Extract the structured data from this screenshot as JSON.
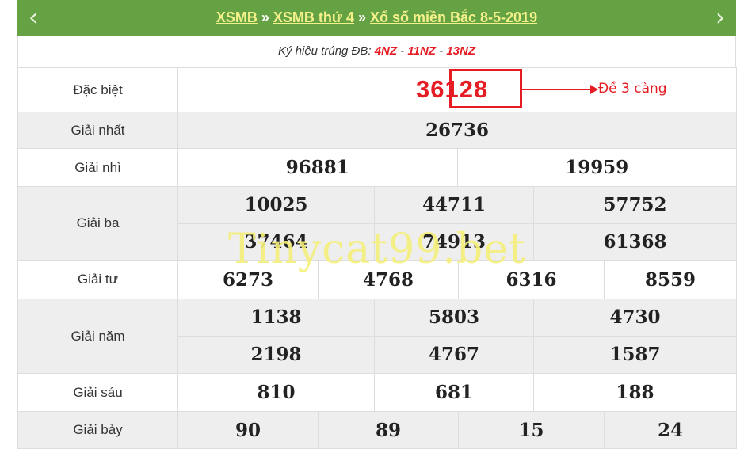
{
  "nav": {
    "prev": "‹",
    "next": "›"
  },
  "breadcrumb": {
    "items": [
      "XSMB",
      "XSMB thứ 4",
      "Xổ số miền Bắc 8-5-2019"
    ],
    "separator": "»"
  },
  "kyhieu": {
    "label": "Ký hiệu trúng ĐB:",
    "codes": [
      "4NZ",
      "11NZ",
      "13NZ"
    ],
    "dash": "-"
  },
  "prizes": {
    "dac_biet": {
      "label": "Đặc biệt",
      "number": "36128",
      "prefix": "36",
      "highlight": "128"
    },
    "nhat": {
      "label": "Giải nhất",
      "numbers": [
        "26736"
      ]
    },
    "nhi": {
      "label": "Giải nhì",
      "numbers": [
        "96881",
        "19959"
      ]
    },
    "ba": {
      "label": "Giải ba",
      "numbers": [
        "10025",
        "44711",
        "57752",
        "37464",
        "74913",
        "61368"
      ]
    },
    "tu": {
      "label": "Giải tư",
      "numbers": [
        "6273",
        "4768",
        "6316",
        "8559"
      ]
    },
    "nam": {
      "label": "Giải năm",
      "numbers": [
        "1138",
        "5803",
        "4730",
        "2198",
        "4767",
        "1587"
      ]
    },
    "sau": {
      "label": "Giải sáu",
      "numbers": [
        "810",
        "681",
        "188"
      ]
    },
    "bay": {
      "label": "Giải bảy",
      "numbers": [
        "90",
        "89",
        "15",
        "24"
      ]
    }
  },
  "annotation": {
    "label": "Đề 3 càng"
  },
  "watermark": "Tinycat99.bet",
  "colors": {
    "header": "#65a243",
    "link": "#f4f08a",
    "red": "#e51c23",
    "gray_row": "#eeeeee"
  }
}
